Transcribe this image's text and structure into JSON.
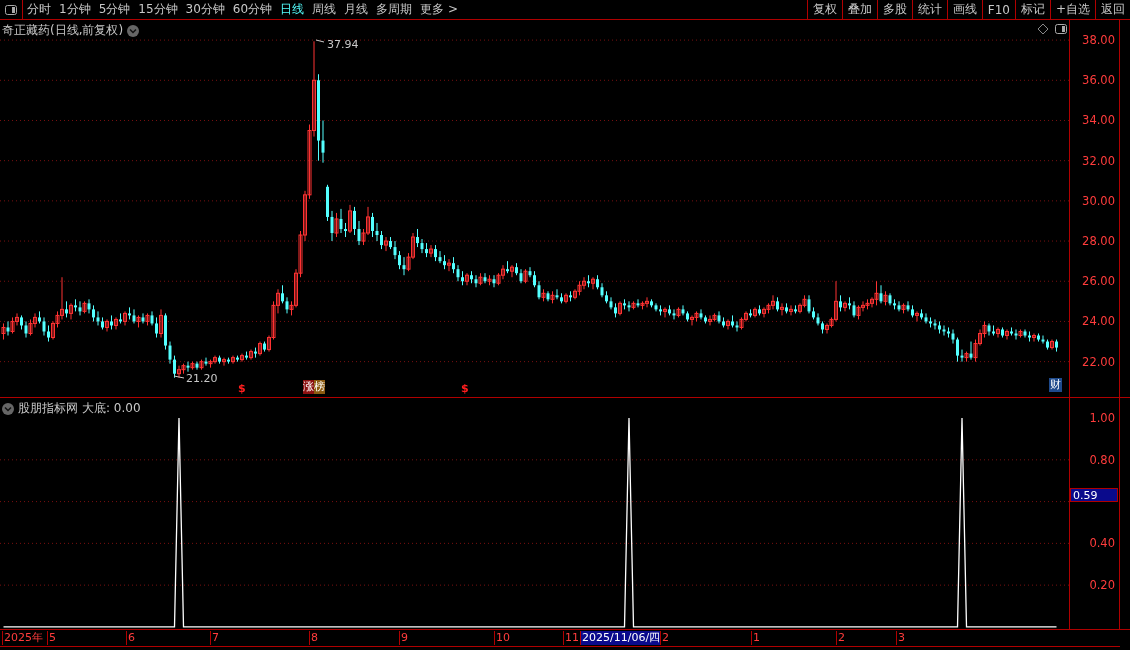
{
  "toolbar": {
    "periods": [
      {
        "label": "分时",
        "selected": false
      },
      {
        "label": "1分钟",
        "selected": false
      },
      {
        "label": "5分钟",
        "selected": false
      },
      {
        "label": "15分钟",
        "selected": false
      },
      {
        "label": "30分钟",
        "selected": false
      },
      {
        "label": "60分钟",
        "selected": false
      },
      {
        "label": "日线",
        "selected": true
      },
      {
        "label": "周线",
        "selected": false
      },
      {
        "label": "月线",
        "selected": false
      },
      {
        "label": "多周期",
        "selected": false
      },
      {
        "label": "更多 >",
        "selected": false
      }
    ],
    "buttons": [
      "复权",
      "叠加",
      "多股",
      "统计",
      "画线",
      "F10",
      "标记",
      "+自选",
      "返回"
    ]
  },
  "price_chart": {
    "title": "奇正藏药(日线,前复权)",
    "high_label": "37.94",
    "low_label": "21.20",
    "markers": [
      {
        "kind": "signal",
        "label": "$"
      },
      {
        "kind": "badge",
        "label": "涨榜"
      },
      {
        "kind": "signal",
        "label": "$"
      },
      {
        "kind": "finance",
        "label": "财"
      }
    ],
    "chart_data": {
      "type": "candlestick",
      "grid": true,
      "ylim": [
        20.24,
        39.0
      ],
      "yticks": [
        {
          "value": 38,
          "label": "38.00"
        },
        {
          "value": 36,
          "label": "36.00"
        },
        {
          "value": 34,
          "label": "34.00"
        },
        {
          "value": 32,
          "label": "32.00"
        },
        {
          "value": 30,
          "label": "30.00"
        },
        {
          "value": 28,
          "label": "28.00"
        },
        {
          "value": 26,
          "label": "26.00"
        },
        {
          "value": 24,
          "label": "24.00"
        },
        {
          "value": 22,
          "label": "22.00"
        }
      ],
      "ohlc": [
        [
          23.4,
          23.9,
          23.1,
          23.7
        ],
        [
          23.7,
          24.0,
          23.3,
          23.5
        ],
        [
          23.5,
          24.2,
          23.4,
          24.0
        ],
        [
          24.0,
          24.4,
          23.8,
          24.2
        ],
        [
          24.2,
          24.3,
          23.6,
          23.8
        ],
        [
          23.8,
          24.0,
          23.2,
          23.4
        ],
        [
          23.4,
          24.1,
          23.3,
          23.9
        ],
        [
          23.9,
          24.4,
          23.7,
          24.2
        ],
        [
          24.2,
          24.5,
          23.9,
          24.0
        ],
        [
          24.0,
          24.2,
          23.3,
          23.5
        ],
        [
          23.5,
          23.8,
          23.0,
          23.2
        ],
        [
          23.2,
          24.0,
          23.1,
          23.9
        ],
        [
          23.9,
          24.5,
          23.7,
          24.3
        ],
        [
          24.3,
          26.2,
          24.1,
          24.6
        ],
        [
          24.6,
          25.0,
          24.2,
          24.4
        ],
        [
          24.4,
          24.9,
          24.1,
          24.8
        ],
        [
          24.8,
          25.1,
          24.5,
          24.7
        ],
        [
          24.7,
          25.0,
          24.3,
          24.5
        ],
        [
          24.5,
          25.0,
          24.4,
          24.9
        ],
        [
          24.9,
          25.1,
          24.4,
          24.6
        ],
        [
          24.6,
          24.8,
          24.0,
          24.2
        ],
        [
          24.2,
          24.5,
          23.8,
          24.0
        ],
        [
          24.0,
          24.2,
          23.6,
          23.7
        ],
        [
          23.7,
          24.1,
          23.5,
          24.0
        ],
        [
          24.0,
          24.3,
          23.6,
          23.8
        ],
        [
          23.8,
          24.2,
          23.6,
          24.1
        ],
        [
          24.1,
          24.4,
          23.9,
          24.0
        ],
        [
          24.0,
          24.5,
          23.8,
          24.4
        ],
        [
          24.4,
          24.7,
          24.1,
          24.3
        ],
        [
          24.3,
          24.6,
          23.9,
          24.0
        ],
        [
          24.0,
          24.3,
          23.7,
          24.2
        ],
        [
          24.2,
          24.4,
          23.9,
          24.0
        ],
        [
          24.0,
          24.4,
          23.8,
          24.3
        ],
        [
          24.3,
          24.5,
          23.8,
          23.9
        ],
        [
          23.9,
          24.2,
          23.2,
          23.4
        ],
        [
          23.4,
          24.6,
          23.2,
          24.3
        ],
        [
          24.3,
          24.4,
          22.6,
          22.8
        ],
        [
          22.8,
          23.0,
          21.9,
          22.1
        ],
        [
          22.1,
          22.3,
          21.2,
          21.4
        ],
        [
          21.4,
          21.8,
          21.2,
          21.6
        ],
        [
          21.6,
          21.9,
          21.4,
          21.8
        ],
        [
          21.8,
          22.0,
          21.5,
          21.7
        ],
        [
          21.7,
          22.0,
          21.6,
          21.9
        ],
        [
          21.9,
          22.0,
          21.6,
          21.7
        ],
        [
          21.7,
          22.1,
          21.6,
          22.0
        ],
        [
          22.0,
          22.2,
          21.8,
          21.9
        ],
        [
          21.9,
          22.1,
          21.7,
          22.0
        ],
        [
          22.0,
          22.3,
          21.9,
          22.2
        ],
        [
          22.2,
          22.3,
          21.9,
          22.0
        ],
        [
          22.0,
          22.2,
          21.8,
          22.1
        ],
        [
          22.1,
          22.2,
          21.9,
          22.0
        ],
        [
          22.0,
          22.3,
          21.9,
          22.2
        ],
        [
          22.2,
          22.3,
          22.0,
          22.1
        ],
        [
          22.1,
          22.4,
          22.0,
          22.3
        ],
        [
          22.3,
          22.5,
          22.1,
          22.2
        ],
        [
          22.2,
          22.6,
          22.1,
          22.5
        ],
        [
          22.5,
          22.7,
          22.2,
          22.4
        ],
        [
          22.4,
          23.0,
          22.3,
          22.9
        ],
        [
          22.9,
          23.0,
          22.5,
          22.6
        ],
        [
          22.6,
          23.3,
          22.5,
          23.2
        ],
        [
          23.2,
          25.0,
          23.1,
          24.8
        ],
        [
          24.8,
          25.6,
          24.4,
          25.4
        ],
        [
          25.4,
          25.8,
          24.9,
          25.0
        ],
        [
          25.0,
          25.2,
          24.4,
          24.6
        ],
        [
          24.6,
          25.0,
          24.3,
          24.8
        ],
        [
          24.8,
          26.6,
          24.7,
          26.4
        ],
        [
          26.4,
          28.5,
          26.2,
          28.3
        ],
        [
          28.3,
          30.5,
          28.0,
          30.3
        ],
        [
          30.3,
          33.8,
          30.1,
          33.5
        ],
        [
          33.5,
          37.94,
          33.2,
          36.0
        ],
        [
          36.0,
          36.3,
          32.0,
          33.0
        ],
        [
          33.0,
          34.0,
          31.9,
          32.4
        ],
        [
          30.7,
          30.8,
          29.0,
          29.2
        ],
        [
          29.2,
          29.5,
          28.0,
          28.4
        ],
        [
          28.4,
          29.4,
          28.2,
          29.1
        ],
        [
          29.1,
          29.6,
          28.4,
          28.6
        ],
        [
          28.6,
          28.9,
          28.2,
          28.5
        ],
        [
          28.5,
          29.8,
          28.4,
          29.5
        ],
        [
          29.5,
          29.7,
          28.3,
          28.6
        ],
        [
          28.6,
          29.0,
          27.8,
          28.0
        ],
        [
          28.0,
          28.6,
          27.8,
          28.4
        ],
        [
          28.4,
          29.7,
          28.3,
          29.2
        ],
        [
          29.2,
          29.4,
          28.2,
          28.5
        ],
        [
          28.5,
          28.9,
          28.0,
          28.3
        ],
        [
          28.3,
          28.5,
          27.6,
          27.8
        ],
        [
          27.8,
          28.2,
          27.5,
          28.0
        ],
        [
          28.0,
          28.2,
          27.6,
          27.7
        ],
        [
          27.7,
          28.0,
          27.1,
          27.3
        ],
        [
          27.3,
          27.5,
          26.6,
          26.8
        ],
        [
          26.8,
          27.2,
          26.3,
          26.6
        ],
        [
          26.6,
          27.4,
          26.5,
          27.2
        ],
        [
          27.2,
          28.4,
          27.1,
          28.2
        ],
        [
          28.2,
          28.6,
          27.7,
          27.9
        ],
        [
          27.9,
          28.1,
          27.4,
          27.6
        ],
        [
          27.6,
          27.9,
          27.2,
          27.4
        ],
        [
          27.4,
          27.8,
          27.2,
          27.6
        ],
        [
          27.6,
          27.8,
          27.0,
          27.2
        ],
        [
          27.2,
          27.5,
          26.9,
          27.0
        ],
        [
          27.0,
          27.3,
          26.6,
          26.8
        ],
        [
          26.8,
          27.1,
          26.5,
          26.9
        ],
        [
          26.9,
          27.2,
          26.4,
          26.6
        ],
        [
          26.6,
          26.8,
          26.0,
          26.2
        ],
        [
          26.2,
          26.5,
          25.8,
          26.0
        ],
        [
          26.0,
          26.4,
          25.8,
          26.3
        ],
        [
          26.3,
          26.5,
          25.9,
          26.1
        ],
        [
          26.1,
          26.3,
          25.7,
          25.9
        ],
        [
          25.9,
          26.4,
          25.8,
          26.2
        ],
        [
          26.2,
          26.4,
          25.9,
          26.0
        ],
        [
          26.0,
          26.3,
          25.8,
          26.1
        ],
        [
          26.1,
          26.3,
          25.7,
          25.9
        ],
        [
          25.9,
          26.4,
          25.8,
          26.3
        ],
        [
          26.3,
          26.8,
          26.1,
          26.6
        ],
        [
          26.6,
          27.0,
          26.4,
          26.5
        ],
        [
          26.5,
          26.8,
          26.2,
          26.7
        ],
        [
          26.7,
          26.9,
          26.3,
          26.4
        ],
        [
          26.4,
          26.6,
          25.9,
          26.0
        ],
        [
          26.0,
          26.6,
          25.9,
          26.5
        ],
        [
          26.5,
          26.7,
          26.2,
          26.3
        ],
        [
          26.3,
          26.5,
          25.7,
          25.8
        ],
        [
          25.8,
          26.0,
          25.1,
          25.2
        ],
        [
          25.2,
          25.6,
          25.0,
          25.4
        ],
        [
          25.4,
          25.5,
          25.0,
          25.1
        ],
        [
          25.1,
          25.5,
          24.9,
          25.3
        ],
        [
          25.3,
          25.6,
          25.1,
          25.2
        ],
        [
          25.2,
          25.4,
          24.9,
          25.0
        ],
        [
          25.0,
          25.4,
          24.9,
          25.3
        ],
        [
          25.3,
          25.5,
          25.0,
          25.2
        ],
        [
          25.2,
          25.6,
          25.1,
          25.5
        ],
        [
          25.5,
          26.0,
          25.3,
          25.8
        ],
        [
          25.8,
          26.2,
          25.6,
          26.0
        ],
        [
          26.0,
          26.3,
          25.7,
          25.9
        ],
        [
          25.9,
          26.2,
          25.6,
          26.1
        ],
        [
          26.1,
          26.3,
          25.6,
          25.7
        ],
        [
          25.7,
          25.9,
          25.2,
          25.3
        ],
        [
          25.3,
          25.5,
          24.9,
          25.0
        ],
        [
          25.0,
          25.2,
          24.6,
          24.7
        ],
        [
          24.7,
          24.9,
          24.2,
          24.4
        ],
        [
          24.4,
          25.0,
          24.3,
          24.9
        ],
        [
          24.9,
          25.1,
          24.6,
          24.8
        ],
        [
          24.8,
          25.0,
          24.5,
          24.7
        ],
        [
          24.7,
          25.0,
          24.6,
          24.9
        ],
        [
          24.9,
          25.1,
          24.7,
          24.8
        ],
        [
          24.8,
          25.0,
          24.6,
          24.9
        ],
        [
          24.9,
          25.2,
          24.7,
          25.0
        ],
        [
          25.0,
          25.1,
          24.7,
          24.8
        ],
        [
          24.8,
          24.9,
          24.5,
          24.6
        ],
        [
          24.6,
          24.8,
          24.3,
          24.5
        ],
        [
          24.5,
          24.7,
          24.2,
          24.6
        ],
        [
          24.6,
          24.8,
          24.3,
          24.4
        ],
        [
          24.4,
          24.6,
          24.1,
          24.3
        ],
        [
          24.3,
          24.7,
          24.2,
          24.6
        ],
        [
          24.6,
          24.8,
          24.3,
          24.4
        ],
        [
          24.4,
          24.5,
          24.0,
          24.1
        ],
        [
          24.1,
          24.3,
          23.8,
          24.2
        ],
        [
          24.2,
          24.5,
          24.0,
          24.4
        ],
        [
          24.4,
          24.6,
          24.1,
          24.2
        ],
        [
          24.2,
          24.3,
          23.9,
          24.0
        ],
        [
          24.0,
          24.3,
          23.8,
          24.1
        ],
        [
          24.1,
          24.4,
          24.0,
          24.3
        ],
        [
          24.3,
          24.5,
          23.9,
          24.0
        ],
        [
          24.0,
          24.2,
          23.7,
          23.8
        ],
        [
          23.8,
          24.1,
          23.6,
          24.0
        ],
        [
          24.0,
          24.3,
          23.7,
          23.8
        ],
        [
          23.8,
          24.0,
          23.5,
          23.7
        ],
        [
          23.7,
          24.2,
          23.6,
          24.1
        ],
        [
          24.1,
          24.5,
          24.0,
          24.4
        ],
        [
          24.4,
          24.6,
          24.2,
          24.3
        ],
        [
          24.3,
          24.7,
          24.2,
          24.6
        ],
        [
          24.6,
          24.8,
          24.3,
          24.4
        ],
        [
          24.4,
          24.7,
          24.2,
          24.6
        ],
        [
          24.6,
          24.9,
          24.4,
          24.8
        ],
        [
          24.8,
          25.3,
          24.6,
          25.0
        ],
        [
          25.0,
          25.2,
          24.5,
          24.6
        ],
        [
          24.6,
          24.9,
          24.3,
          24.7
        ],
        [
          24.7,
          24.9,
          24.4,
          24.5
        ],
        [
          24.5,
          24.8,
          24.3,
          24.6
        ],
        [
          24.6,
          24.8,
          24.4,
          24.5
        ],
        [
          24.5,
          24.9,
          24.4,
          24.8
        ],
        [
          24.8,
          25.3,
          24.7,
          25.1
        ],
        [
          25.1,
          25.3,
          24.4,
          24.5
        ],
        [
          24.5,
          24.7,
          24.1,
          24.2
        ],
        [
          24.2,
          24.4,
          23.8,
          23.9
        ],
        [
          23.9,
          24.0,
          23.4,
          23.6
        ],
        [
          23.6,
          23.9,
          23.4,
          23.8
        ],
        [
          23.8,
          24.2,
          23.7,
          24.1
        ],
        [
          24.1,
          26.0,
          24.0,
          25.0
        ],
        [
          25.0,
          25.3,
          24.5,
          24.7
        ],
        [
          24.7,
          25.0,
          24.5,
          24.9
        ],
        [
          24.9,
          25.2,
          24.6,
          24.8
        ],
        [
          24.8,
          25.0,
          24.2,
          24.3
        ],
        [
          24.3,
          24.8,
          24.1,
          24.7
        ],
        [
          24.7,
          25.0,
          24.5,
          24.8
        ],
        [
          24.8,
          25.1,
          24.6,
          24.9
        ],
        [
          24.9,
          25.2,
          24.7,
          25.1
        ],
        [
          25.1,
          26.0,
          24.8,
          25.4
        ],
        [
          25.4,
          25.8,
          24.9,
          25.0
        ],
        [
          25.0,
          25.5,
          24.8,
          25.3
        ],
        [
          25.3,
          25.4,
          24.8,
          24.9
        ],
        [
          24.9,
          25.1,
          24.6,
          24.8
        ],
        [
          24.8,
          25.0,
          24.5,
          24.6
        ],
        [
          24.6,
          24.9,
          24.4,
          24.8
        ],
        [
          24.8,
          25.0,
          24.5,
          24.6
        ],
        [
          24.6,
          24.8,
          24.2,
          24.3
        ],
        [
          24.3,
          24.5,
          24.0,
          24.4
        ],
        [
          24.4,
          24.6,
          24.1,
          24.2
        ],
        [
          24.2,
          24.4,
          23.9,
          24.0
        ],
        [
          24.0,
          24.2,
          23.7,
          23.9
        ],
        [
          23.9,
          24.1,
          23.6,
          23.8
        ],
        [
          23.8,
          24.0,
          23.4,
          23.6
        ],
        [
          23.6,
          23.8,
          23.3,
          23.5
        ],
        [
          23.5,
          23.7,
          23.2,
          23.4
        ],
        [
          23.4,
          23.6,
          22.9,
          23.1
        ],
        [
          23.1,
          23.2,
          22.0,
          22.3
        ],
        [
          22.3,
          22.6,
          22.0,
          22.2
        ],
        [
          22.2,
          22.5,
          22.0,
          22.4
        ],
        [
          22.4,
          23.0,
          22.1,
          22.2
        ],
        [
          22.2,
          23.1,
          22.0,
          22.9
        ],
        [
          22.9,
          23.6,
          22.8,
          23.4
        ],
        [
          23.4,
          24.0,
          23.2,
          23.8
        ],
        [
          23.8,
          23.9,
          23.3,
          23.5
        ],
        [
          23.5,
          23.8,
          23.3,
          23.4
        ],
        [
          23.4,
          23.7,
          23.2,
          23.6
        ],
        [
          23.6,
          23.7,
          23.2,
          23.3
        ],
        [
          23.3,
          23.6,
          23.1,
          23.5
        ],
        [
          23.5,
          23.7,
          23.3,
          23.4
        ],
        [
          23.4,
          23.6,
          23.1,
          23.3
        ],
        [
          23.3,
          23.6,
          23.2,
          23.5
        ],
        [
          23.5,
          23.6,
          23.2,
          23.3
        ],
        [
          23.3,
          23.5,
          23.0,
          23.2
        ],
        [
          23.2,
          23.4,
          23.0,
          23.3
        ],
        [
          23.3,
          23.4,
          23.0,
          23.1
        ],
        [
          23.1,
          23.3,
          22.9,
          23.0
        ],
        [
          23.0,
          23.1,
          22.6,
          22.7
        ],
        [
          22.7,
          23.1,
          22.6,
          23.0
        ],
        [
          23.0,
          23.1,
          22.5,
          22.7
        ]
      ]
    }
  },
  "indicator": {
    "title": "股朋指标网",
    "reading": "大底: 0.00",
    "cursor_value": "0.59",
    "chart_data": {
      "type": "line",
      "grid": true,
      "ylim": [
        -0.01,
        1.096
      ],
      "yticks": [
        {
          "value": 1,
          "label": "1.00"
        },
        {
          "value": 0.8,
          "label": "0.80"
        },
        {
          "value": 0.4,
          "label": "0.40"
        },
        {
          "value": 0.2,
          "label": "0.20"
        }
      ],
      "series": [
        {
          "color": "#ffffff",
          "values": [
            0,
            0,
            0,
            0,
            0,
            0,
            0,
            0,
            0,
            0,
            0,
            0,
            0,
            0,
            0,
            0,
            0,
            0,
            0,
            0,
            0,
            0,
            0,
            0,
            0,
            0,
            0,
            0,
            0,
            0,
            0,
            0,
            0,
            0,
            0,
            0,
            0,
            0,
            0,
            1,
            0,
            0,
            0,
            0,
            0,
            0,
            0,
            0,
            0,
            0,
            0,
            0,
            0,
            0,
            0,
            0,
            0,
            0,
            0,
            0,
            0,
            0,
            0,
            0,
            0,
            0,
            0,
            0,
            0,
            0,
            0,
            0,
            0,
            0,
            0,
            0,
            0,
            0,
            0,
            0,
            0,
            0,
            0,
            0,
            0,
            0,
            0,
            0,
            0,
            0,
            0,
            0,
            0,
            0,
            0,
            0,
            0,
            0,
            0,
            0,
            0,
            0,
            0,
            0,
            0,
            0,
            0,
            0,
            0,
            0,
            0,
            0,
            0,
            0,
            0,
            0,
            0,
            0,
            0,
            0,
            0,
            0,
            0,
            0,
            0,
            0,
            0,
            0,
            0,
            0,
            0,
            0,
            0,
            0,
            0,
            0,
            0,
            0,
            0,
            1,
            0,
            0,
            0,
            0,
            0,
            0,
            0,
            0,
            0,
            0,
            0,
            0,
            0,
            0,
            0,
            0,
            0,
            0,
            0,
            0,
            0,
            0,
            0,
            0,
            0,
            0,
            0,
            0,
            0,
            0,
            0,
            0,
            0,
            0,
            0,
            0,
            0,
            0,
            0,
            0,
            0,
            0,
            0,
            0,
            0,
            0,
            0,
            0,
            0,
            0,
            0,
            0,
            0,
            0,
            0,
            0,
            0,
            0,
            0,
            0,
            0,
            0,
            0,
            0,
            0,
            0,
            0,
            0,
            0,
            0,
            0,
            0,
            0,
            1,
            0,
            0,
            0,
            0,
            0,
            0,
            0,
            0,
            0,
            0,
            0,
            0,
            0,
            0,
            0,
            0,
            0,
            0,
            0,
            0,
            0
          ]
        }
      ]
    }
  },
  "date_axis": [
    {
      "label": "2025年",
      "highlighted": false
    },
    {
      "label": "5",
      "highlighted": false
    },
    {
      "label": "6",
      "highlighted": false
    },
    {
      "label": "7",
      "highlighted": false
    },
    {
      "label": "8",
      "highlighted": false
    },
    {
      "label": "9",
      "highlighted": false
    },
    {
      "label": "10",
      "highlighted": false
    },
    {
      "label": "11",
      "highlighted": false
    },
    {
      "label": "2025/11/06/四",
      "highlighted": true
    },
    {
      "label": "2",
      "highlighted": false
    },
    {
      "label": "1",
      "highlighted": false
    },
    {
      "label": "2",
      "highlighted": false
    },
    {
      "label": "3",
      "highlighted": false
    }
  ]
}
